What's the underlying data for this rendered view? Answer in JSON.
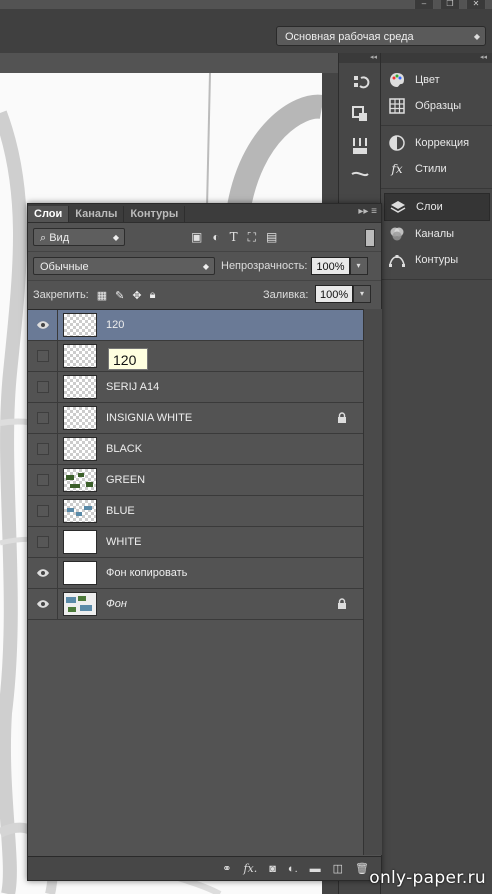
{
  "window": {
    "minimize": "–",
    "restore": "❐",
    "close": "✕"
  },
  "workspace": {
    "label": "Основная рабочая среда"
  },
  "dock": {
    "collapse_label": "◂◂",
    "panels": [
      {
        "group": 1,
        "items": [
          {
            "name": "Цвет",
            "icon": "color-palette-icon"
          },
          {
            "name": "Образцы",
            "icon": "swatches-grid-icon"
          }
        ]
      },
      {
        "group": 2,
        "items": [
          {
            "name": "Коррекция",
            "icon": "adjustment-circle-icon"
          },
          {
            "name": "Стили",
            "icon": "fx-styles-icon"
          }
        ]
      },
      {
        "group": 3,
        "items": [
          {
            "name": "Слои",
            "icon": "layers-stack-icon",
            "active": true
          },
          {
            "name": "Каналы",
            "icon": "channels-icon"
          },
          {
            "name": "Контуры",
            "icon": "paths-pen-icon"
          }
        ]
      }
    ]
  },
  "layers_panel": {
    "tabs": [
      "Слои",
      "Каналы",
      "Контуры"
    ],
    "active_tab": "Слои",
    "filter_label": "Вид",
    "blend_mode": "Обычные",
    "opacity_label": "Непрозрачность:",
    "opacity_value": "100%",
    "lock_label": "Закрепить:",
    "fill_label": "Заливка:",
    "fill_value": "100%",
    "layers": [
      {
        "name": "120",
        "visible": true,
        "selected": true,
        "locked": false,
        "italic": false,
        "thumb": "transparent"
      },
      {
        "name": "",
        "visible": false,
        "selected": false,
        "locked": false,
        "italic": false,
        "thumb": "transparent"
      },
      {
        "name": "SERIJ A14",
        "visible": false,
        "selected": false,
        "locked": false,
        "italic": false,
        "thumb": "transparent"
      },
      {
        "name": "INSIGNIA WHITE",
        "visible": false,
        "selected": false,
        "locked": true,
        "italic": false,
        "thumb": "transparent"
      },
      {
        "name": "BLACK",
        "visible": false,
        "selected": false,
        "locked": false,
        "italic": false,
        "thumb": "transparent"
      },
      {
        "name": "GREEN",
        "visible": false,
        "selected": false,
        "locked": false,
        "italic": false,
        "thumb": "green"
      },
      {
        "name": "BLUE",
        "visible": false,
        "selected": false,
        "locked": false,
        "italic": false,
        "thumb": "blue"
      },
      {
        "name": "WHITE",
        "visible": false,
        "selected": false,
        "locked": false,
        "italic": false,
        "thumb": "white"
      },
      {
        "name": "Фон копировать",
        "visible": true,
        "selected": false,
        "locked": false,
        "italic": false,
        "thumb": "white"
      },
      {
        "name": "Фон",
        "visible": true,
        "selected": false,
        "locked": true,
        "italic": true,
        "thumb": "photo"
      }
    ],
    "tooltip": "120"
  },
  "watermark": "only-paper.ru",
  "colors": {
    "selected_row": "#6a7a96",
    "panel": "#535353",
    "dock": "#474747"
  }
}
